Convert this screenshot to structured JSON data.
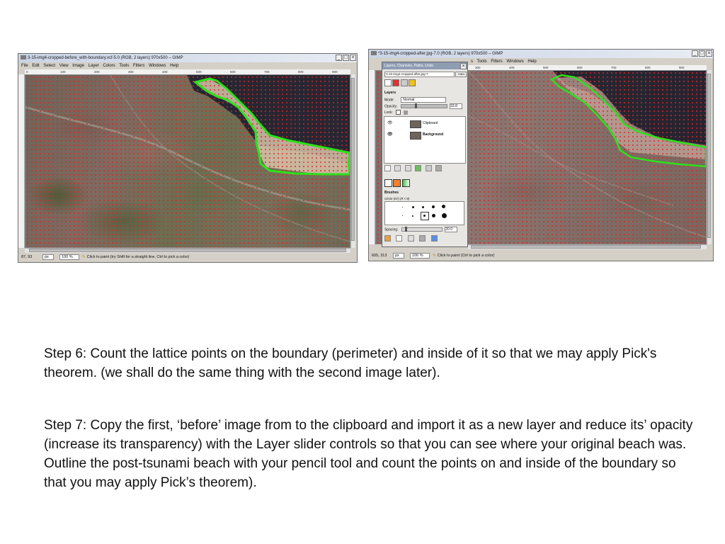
{
  "window_left": {
    "title": "3-15-img4-cropped-before_with-boundary.xcf-5.0 (RGB, 2 layers) 970x500 – GIMP",
    "menu": [
      "File",
      "Edit",
      "Select",
      "View",
      "Image",
      "Layer",
      "Colors",
      "Tools",
      "Filters",
      "Windows",
      "Help"
    ],
    "ruler_ticks": [
      "0",
      "100",
      "200",
      "300",
      "400",
      "500",
      "600",
      "700",
      "800",
      "900"
    ],
    "status": {
      "coords": "87, 93",
      "unit": "px",
      "zoom": "100 %",
      "message": "Click to paint (try Shift for a straight line, Ctrl to pick a color)"
    },
    "controls": {
      "minimize": "_",
      "maximize": "□",
      "close": "×"
    }
  },
  "window_right": {
    "title": "*3-15-img4-cropped-after.jpg-7.0 (RGB, 2 layers) 970x500 – GIMP",
    "menu_visible": [
      "s",
      "Tools",
      "Filters",
      "Windows",
      "Help"
    ],
    "ruler_ticks": [
      "300",
      "400",
      "500",
      "600",
      "700",
      "800",
      "900"
    ],
    "status": {
      "coords": "605, 313",
      "unit": "px",
      "zoom": "100 %",
      "message": "Click to paint (Ctrl to pick a color)"
    },
    "controls": {
      "minimize": "_",
      "maximize": "□",
      "close": "×"
    }
  },
  "dock": {
    "title": "Layers, Channels, Paths, Undo",
    "image_selector": "3-15-img4-cropped-after.jpg-7",
    "auto_button": "Auto",
    "close": "×",
    "layers_title": "Layers",
    "mode_label": "Mode:",
    "mode_value": "Normal",
    "opacity_label": "Opacity:",
    "opacity_value": "33.8",
    "lock_label": "Lock:",
    "layers": [
      {
        "name": "Clipboard"
      },
      {
        "name": "Background"
      }
    ],
    "brushes_title": "Brushes",
    "brush_name": "Circle (07) (9 × 9)",
    "spacing_label": "Spacing:",
    "spacing_value": "20.0"
  },
  "slide": {
    "step6": "Step 6: Count the lattice points on the boundary (perimeter) and inside of it so that we may apply Pick's theorem. (we shall do the same thing with the second image later).",
    "step7": "Step 7: Copy the first, ‘before’ image from to the clipboard and import it as a new layer and reduce its’ opacity (increase its transparency) with the Layer slider controls so that you can see where your original beach was. Outline the post-tsunami beach with your pencil tool and count the points on and inside of the boundary so that you may apply Pick’s theorem)."
  }
}
